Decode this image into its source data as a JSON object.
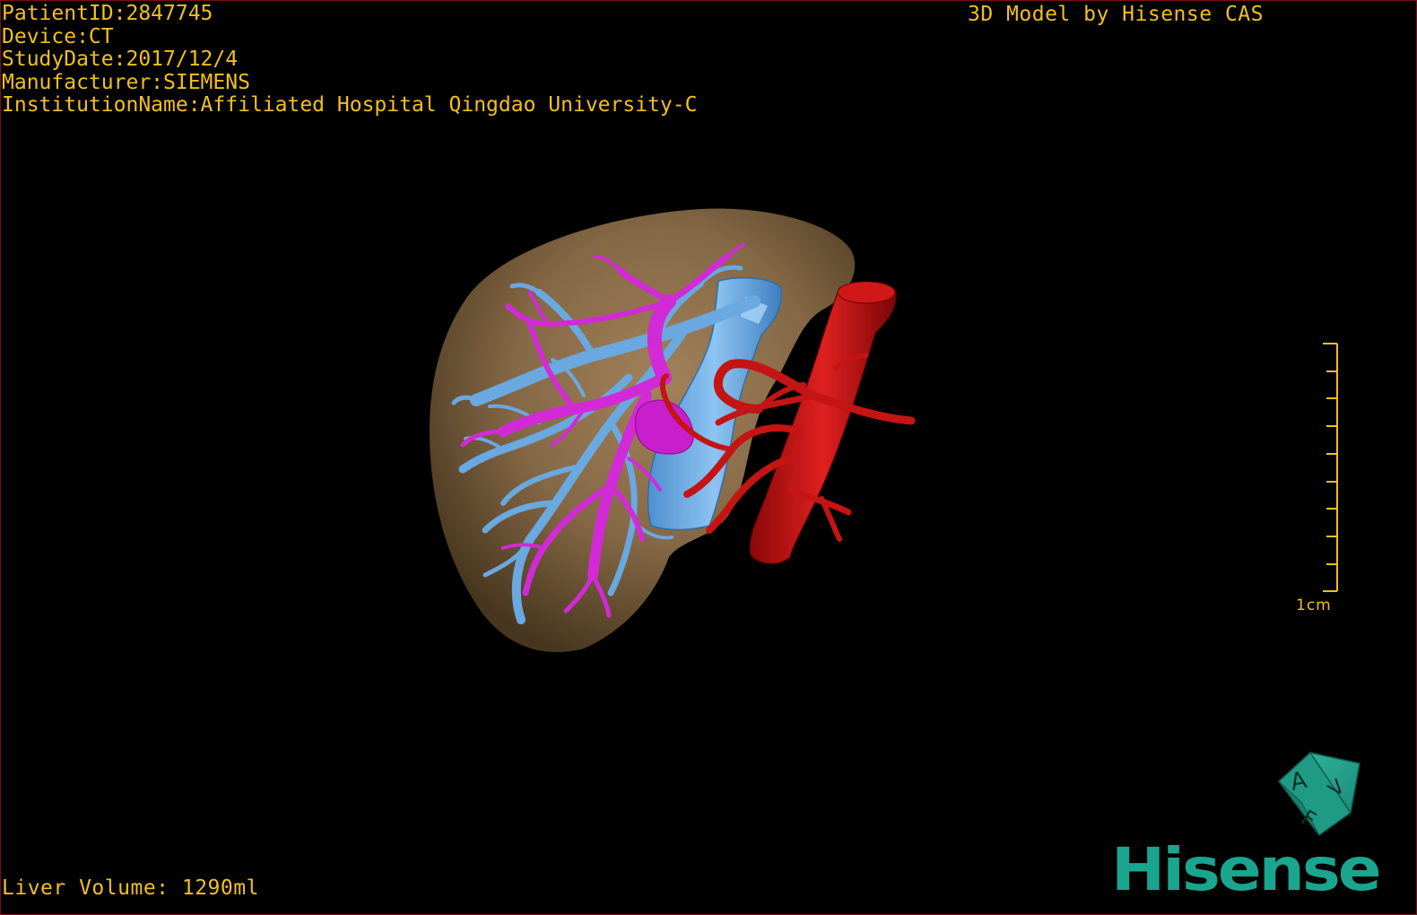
{
  "header": {
    "patient_id": "PatientID:2847745",
    "device": "Device:CT",
    "study_date": "StudyDate:2017/12/4",
    "manufacturer": "Manufacturer:SIEMENS",
    "institution": "InstitutionName:Affiliated Hospital Qingdao University-C"
  },
  "model_credit": "3D Model by Hisense CAS",
  "footer": {
    "liver_volume": "Liver Volume: 1290ml"
  },
  "scale_bar": {
    "label": "1cm"
  },
  "orientation_cube": {
    "labels": [
      "A",
      "F",
      "V"
    ]
  },
  "brand": {
    "name": "Hisense"
  },
  "colors": {
    "overlay_text": "#f0c020",
    "liver": "#8a6c48",
    "portal_vein": "#5b9bd5",
    "hepatic_vein": "#d020d0",
    "artery": "#c01010",
    "brand": "#1aa58e"
  }
}
